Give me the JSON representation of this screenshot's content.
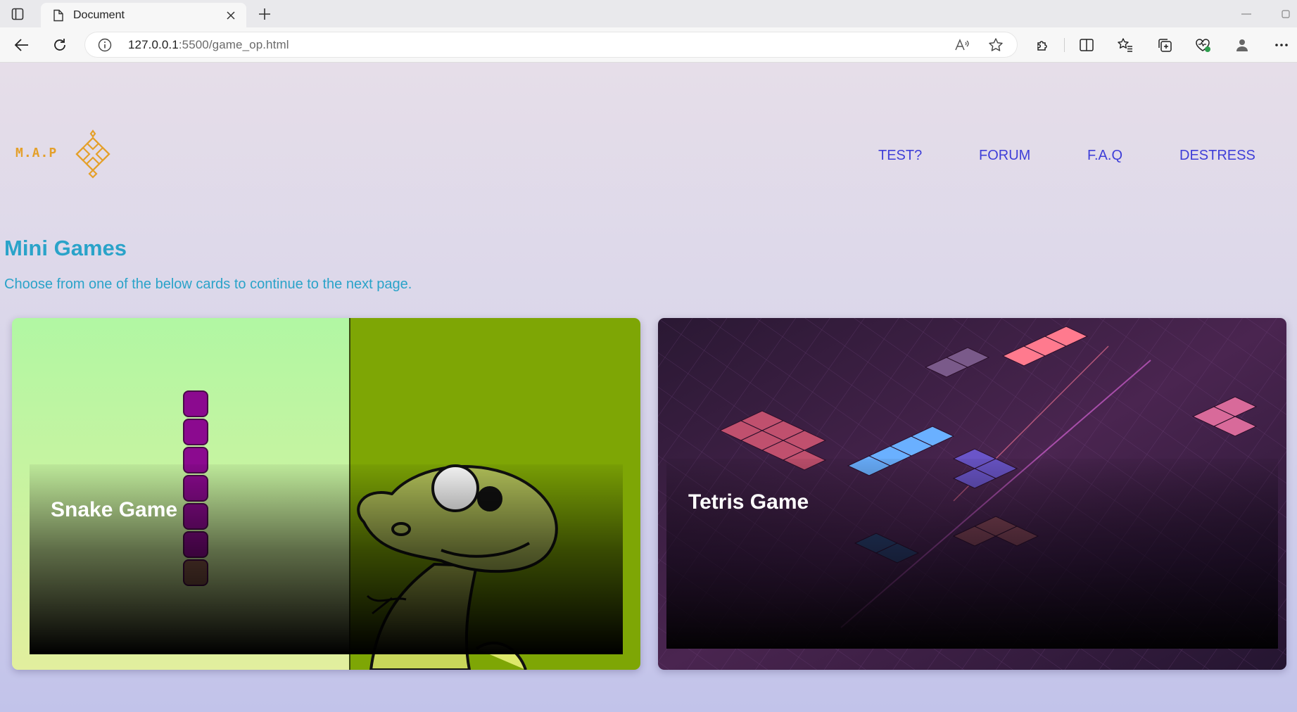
{
  "browser": {
    "tab_title": "Document",
    "url_host": "127.0.0.1",
    "url_path": ":5500/game_op.html"
  },
  "site": {
    "logo_text": "M.A.P",
    "nav": [
      "TEST?",
      "FORUM",
      "F.A.Q",
      "DESTRESS"
    ]
  },
  "main": {
    "heading": "Mini Games",
    "subtitle": "Choose from one of the below cards to continue to the next page.",
    "cards": [
      {
        "title": "Snake Game"
      },
      {
        "title": "Tetris Game"
      }
    ]
  },
  "colors": {
    "heading": "#2aa3c9",
    "nav": "#3f3fd8",
    "logo": "#e4a02a",
    "snake_body": "#8b0a8f"
  }
}
